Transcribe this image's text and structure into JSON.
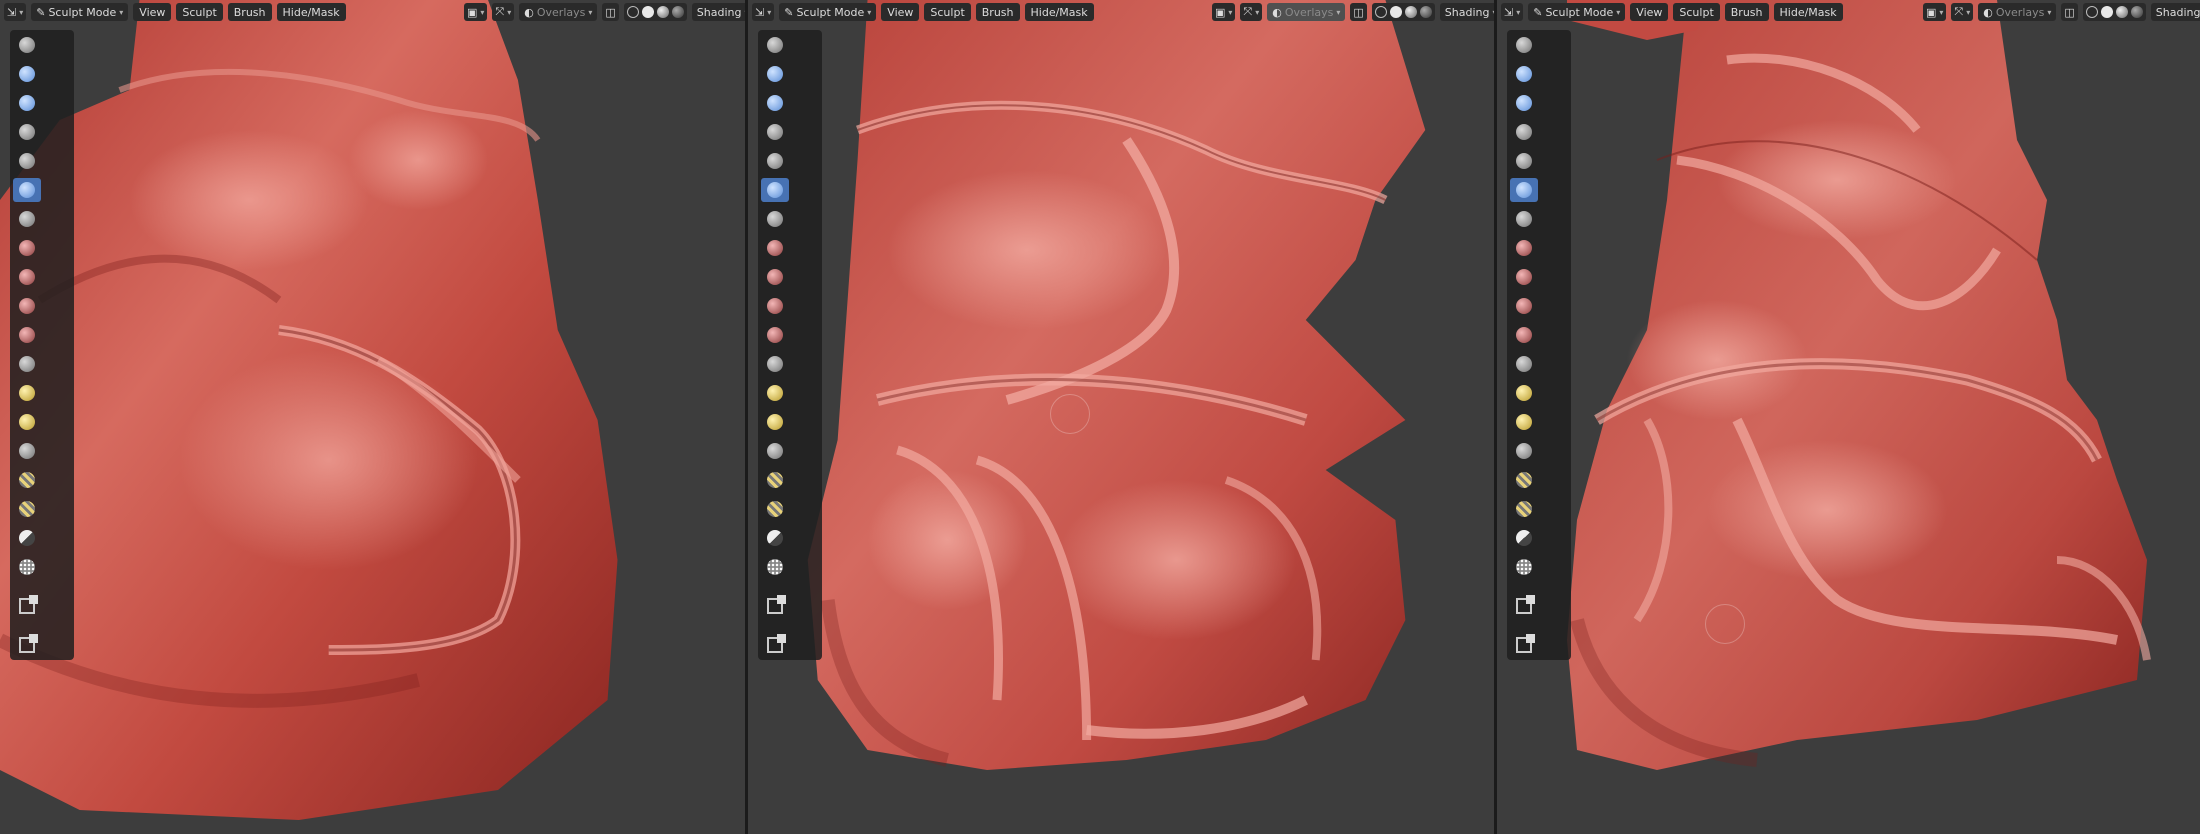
{
  "colors": {
    "viewport_bg": "#3d3d3d",
    "mesh": "#c4473f",
    "mesh_highlight": "#e8958a",
    "mesh_shadow": "#7a1e1a",
    "header_button": "#2a2a2a",
    "tool_active": "#4772b3"
  },
  "viewports": [
    {
      "header": {
        "mode": "Sculpt Mode",
        "menus": [
          "View",
          "Sculpt",
          "Brush",
          "Hide/Mask"
        ],
        "overlays": "Overlays",
        "shading": "Shading"
      }
    },
    {
      "header": {
        "mode": "Sculpt Mode",
        "menus": [
          "View",
          "Sculpt",
          "Brush",
          "Hide/Mask"
        ],
        "overlays": "Overlays",
        "shading": "Shading"
      }
    },
    {
      "header": {
        "mode": "Sculpt Mode",
        "menus": [
          "View",
          "Sculpt",
          "Brush",
          "Hide/Mask"
        ],
        "overlays": "Overlays",
        "shading": "Shading"
      }
    }
  ],
  "toolbar": {
    "tools": [
      {
        "icon": "draw-brush-icon",
        "style": "grey"
      },
      {
        "icon": "draw-sharp-brush-icon",
        "style": "blue"
      },
      {
        "icon": "clay-brush-icon",
        "style": "blue"
      },
      {
        "icon": "clay-strips-brush-icon",
        "style": "grey"
      },
      {
        "icon": "layer-brush-icon",
        "style": "grey"
      },
      {
        "icon": "inflate-brush-icon",
        "style": "blue",
        "active": true
      },
      {
        "icon": "blob-brush-icon",
        "style": "grey"
      },
      {
        "icon": "crease-brush-icon",
        "style": "red"
      },
      {
        "icon": "smooth-brush-icon",
        "style": "red"
      },
      {
        "icon": "flatten-brush-icon",
        "style": "red"
      },
      {
        "icon": "fill-brush-icon",
        "style": "red"
      },
      {
        "icon": "scrape-brush-icon",
        "style": "grey"
      },
      {
        "icon": "pinch-brush-icon",
        "style": "yellow"
      },
      {
        "icon": "grab-brush-icon",
        "style": "yellow"
      },
      {
        "icon": "snake-hook-brush-icon",
        "style": "grey"
      },
      {
        "icon": "thumb-brush-icon",
        "style": "stripe"
      },
      {
        "icon": "pose-brush-icon",
        "style": "stripe"
      },
      {
        "icon": "nudge-brush-icon",
        "style": "half"
      },
      {
        "icon": "mask-brush-icon",
        "style": "dots"
      }
    ],
    "bottom_tools": [
      {
        "icon": "box-mask-icon"
      },
      {
        "icon": "box-hide-icon"
      }
    ]
  }
}
